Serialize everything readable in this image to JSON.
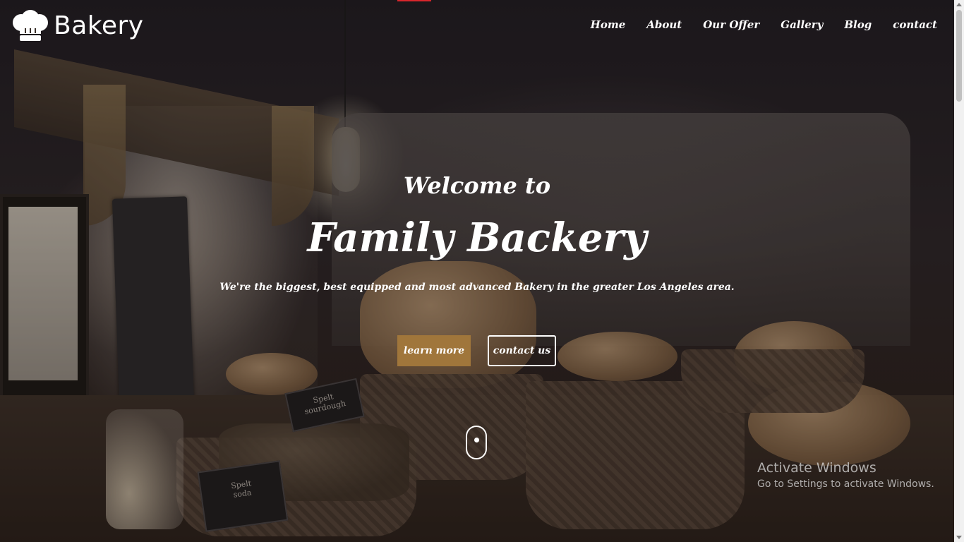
{
  "brand": {
    "name": "Bakery",
    "logo_icon": "chef-hat-icon"
  },
  "nav": {
    "items": [
      {
        "label": "Home"
      },
      {
        "label": "About"
      },
      {
        "label": "Our Offer"
      },
      {
        "label": "Gallery"
      },
      {
        "label": "Blog"
      },
      {
        "label": "contact"
      }
    ]
  },
  "hero": {
    "welcome": "Welcome to",
    "headline": "Family Backery",
    "tagline": "We're the biggest, best equipped and most advanced Bakery in the greater Los Angeles area.",
    "primary_button": "learn more",
    "secondary_button": "contact us",
    "scroll_icon": "mouse-scroll-icon"
  },
  "signs": {
    "sign1_line1": "Spelt",
    "sign1_line2": "sourdough",
    "sign2_line1": "Spelt",
    "sign2_line2": "soda"
  },
  "watermark": {
    "line1": "Activate Windows",
    "line2": "Go to Settings to activate Windows."
  },
  "colors": {
    "accent": "#a0763b",
    "text": "#ffffff"
  }
}
